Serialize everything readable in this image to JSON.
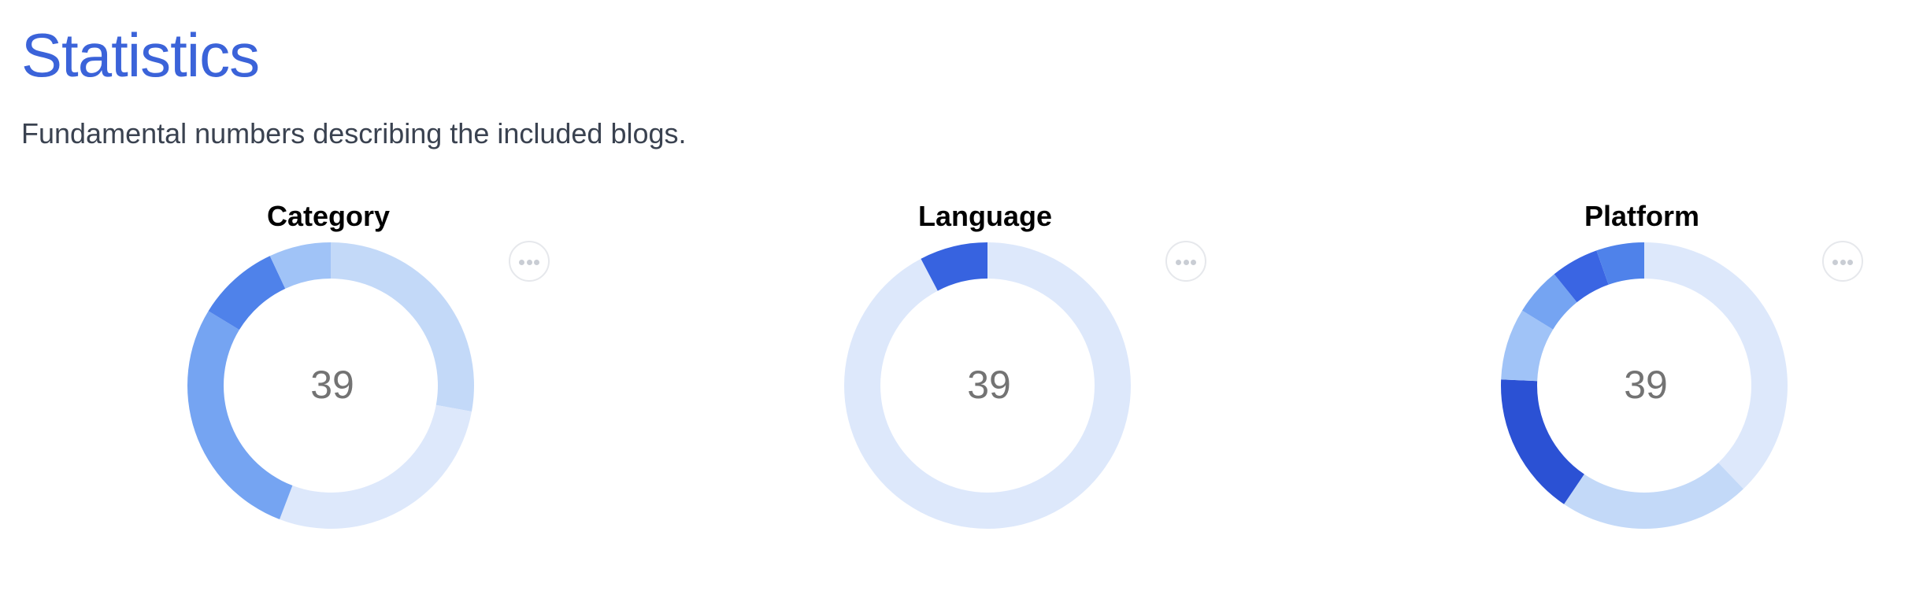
{
  "header": {
    "title": "Statistics",
    "subtitle": "Fundamental numbers describing the included blogs."
  },
  "colors": {
    "title": "#3b63d9",
    "center_text": "#737373",
    "menu_border": "#e6e8ec",
    "menu_dots": "#c9cdd4"
  },
  "chart_data": [
    {
      "type": "pie",
      "style": "donut",
      "title": "Category",
      "center_label": "39",
      "total": 39,
      "values": [
        12,
        12,
        12,
        4,
        3
      ],
      "colors": [
        "#c3d9f8",
        "#dde8fb",
        "#75a4f2",
        "#4f82ea",
        "#a0c3f7"
      ]
    },
    {
      "type": "pie",
      "style": "donut",
      "title": "Language",
      "center_label": "39",
      "total": 39,
      "values": [
        36,
        3
      ],
      "colors": [
        "#dde8fb",
        "#3763e0"
      ]
    },
    {
      "type": "pie",
      "style": "donut",
      "title": "Platform",
      "center_label": "39",
      "total": 39,
      "values": [
        14,
        8,
        6,
        3,
        2,
        2,
        2
      ],
      "colors": [
        "#dde8fb",
        "#c3d9f8",
        "#2b51d4",
        "#a0c3f7",
        "#75a4f2",
        "#3a65e3",
        "#4f82ea"
      ]
    }
  ]
}
